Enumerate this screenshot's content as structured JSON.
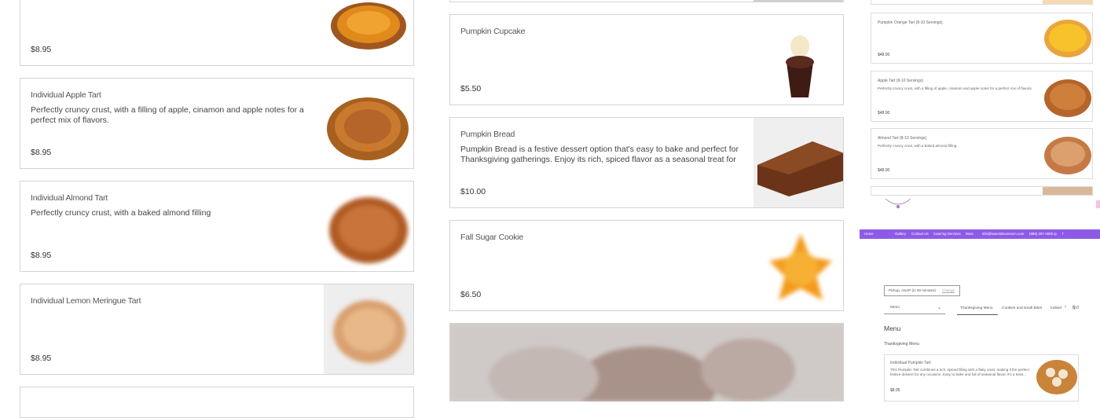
{
  "left_column": {
    "items": [
      {
        "title": "",
        "description": "",
        "price": "$8.95"
      },
      {
        "title": "Individual Apple Tart",
        "description": "Perfectly cruncy crust, with a filling of apple, cinamon and apple notes for a perfect mix of flavors.",
        "price": "$8.95"
      },
      {
        "title": "Individual Almond Tart",
        "description": "Perfectly cruncy crust, with a baked almond filling",
        "price": "$8.95"
      },
      {
        "title": "Individual Lemon Meringue Tart",
        "description": "",
        "price": "$8.95"
      }
    ]
  },
  "middle_column": {
    "items": [
      {
        "title": "Pumpkin Cupcake",
        "description": "",
        "price": "$5.50"
      },
      {
        "title": "Pumpkin Bread",
        "description": "Pumpkin Bread is a festive dessert option that's easy to bake and perfect for Thanksgiving gatherings. Enjoy its rich, spiced flavor as a seasonal treat for family and…",
        "price": "$10.00"
      },
      {
        "title": "Fall Sugar Cookie",
        "description": "",
        "price": "$6.50"
      }
    ]
  },
  "right_column": {
    "items": [
      {
        "title": "Pumpkin Orange Tart (8-10 Servings)",
        "description": "",
        "price": "$48.00"
      },
      {
        "title": "Apple Tart (8-10 Servings)",
        "description": "Perfectly cruncy crust, with a filling of apple, cinamon and apple notes for a perfect mix of flavors.",
        "price": "$48.00"
      },
      {
        "title": "Almond Tart (8-10 Servings)",
        "description": "Perfectly cruncy crust, with a baked almond filling.",
        "price": "$48.00"
      }
    ],
    "nav": [
      "Home",
      "Gallery",
      "Contact Us",
      "Catering Services",
      "More",
      "info@sweetdreamsnm.com",
      "(888) 297-3005"
    ],
    "pickup": {
      "label": "Pickup, ASAP (in 30 minutes)",
      "change": "Change"
    },
    "menu_select": "Menu",
    "tabs": [
      "Thanksgiving Menu",
      "Cookies and small Bites",
      "Individ"
    ],
    "heading": "Menu",
    "subheading": "Thanksgiving Menu",
    "preview_item": {
      "title": "Individual Pumpkin Tart",
      "description": "This Pumpkin Tart combines a rich, spiced filling with a flaky crust, making it the perfect festive dessert for any occasion. Easy to bake and full of seasonal flavor, it's a treat…",
      "price": "$8.95"
    },
    "accent_color": "#8e5be8"
  }
}
